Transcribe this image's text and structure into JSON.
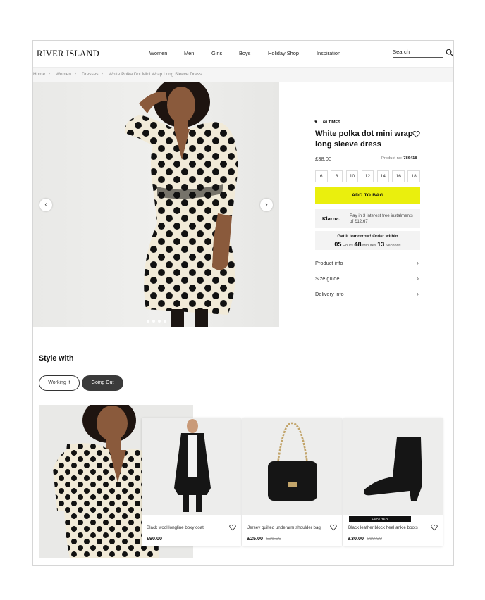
{
  "brand": "RIVER ISLAND",
  "nav": [
    "Women",
    "Men",
    "Girls",
    "Boys",
    "Holiday Shop",
    "Inspiration"
  ],
  "search": {
    "placeholder": "Search"
  },
  "breadcrumb": [
    "Home",
    "Women",
    "Dresses",
    "White Polka Dot Mini Wrap Long Sleeve Dress"
  ],
  "product": {
    "wishlist_count": "60 TIMES",
    "title": "White polka dot mini wrap long sleeve dress",
    "price": "£38.00",
    "product_no_label": "Product no:",
    "product_no": "786418",
    "sizes": [
      "6",
      "8",
      "10",
      "12",
      "14",
      "16",
      "18"
    ],
    "add_to_bag": "ADD TO BAG",
    "klarna_logo": "Klarna.",
    "klarna_text": "Pay in 3 interest free instalments of £12.67",
    "delivery_title": "Get it tomorrow! Order within",
    "timer": {
      "hours": "05",
      "hours_label": "Hours",
      "minutes": "48",
      "minutes_label": "Minutes",
      "seconds": "13",
      "seconds_label": "Seconds"
    },
    "accordion": [
      "Product info",
      "Size guide",
      "Delivery info"
    ],
    "gallery_dots": 4,
    "gallery_active_dot": 0
  },
  "style_with": {
    "title": "Style with",
    "tabs": [
      "Working It",
      "Going Out"
    ],
    "active_tab": "Going Out",
    "items": [
      {
        "name": "Black wool longline boxy coat",
        "price": "£90.00",
        "was": "",
        "badge": ""
      },
      {
        "name": "Jersey quilted underarm shoulder bag",
        "price": "£25.00",
        "was": "£36.00",
        "badge": ""
      },
      {
        "name": "Black leather block heel ankle boots",
        "price": "£30.00",
        "was": "£60.00",
        "badge": "LEATHER"
      }
    ]
  },
  "colors": {
    "accent_yellow": "#eaef0d",
    "active_pill": "#3b3b3b"
  }
}
